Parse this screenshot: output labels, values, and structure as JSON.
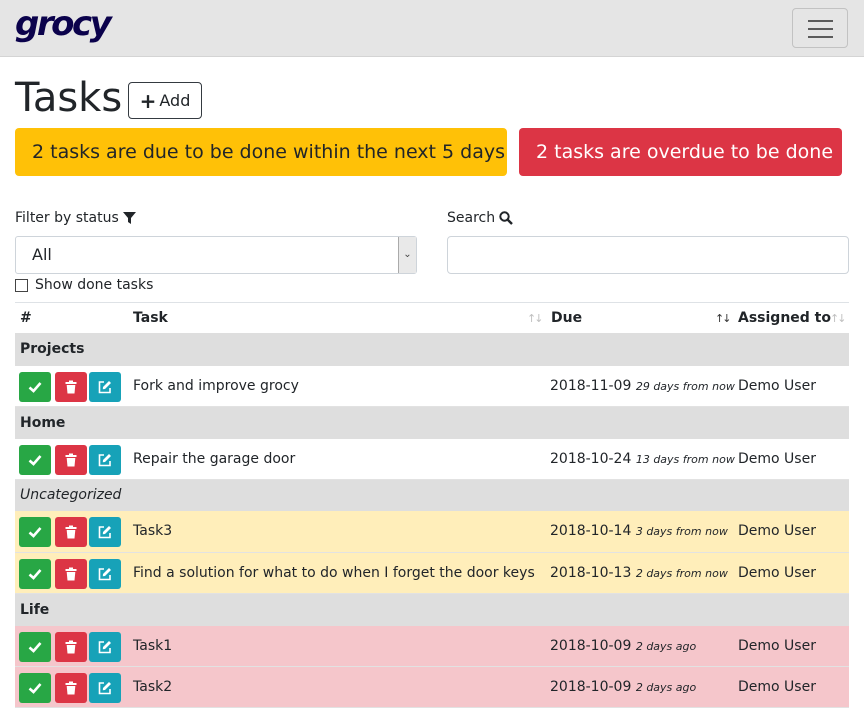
{
  "navbar": {
    "brand": "grocy"
  },
  "page": {
    "title": "Tasks",
    "add_label": "Add"
  },
  "alerts": {
    "due_soon": "2 tasks are due to be done within the next 5 days",
    "overdue": "2 tasks are overdue to be done"
  },
  "filter": {
    "label": "Filter by status",
    "selected": "All"
  },
  "search": {
    "label": "Search",
    "value": ""
  },
  "show_done": {
    "label": "Show done tasks",
    "checked": false
  },
  "table": {
    "columns": {
      "index": "#",
      "task": "Task",
      "due": "Due",
      "assigned": "Assigned to"
    },
    "groups": {
      "projects": "Projects",
      "home": "Home",
      "uncategorized": "Uncategorized",
      "life": "Life"
    },
    "rows": [
      {
        "name": "Fork and improve grocy",
        "due_date": "2018-11-09",
        "due_relative": "29 days from now",
        "assigned": "Demo User",
        "status": "normal"
      },
      {
        "name": "Repair the garage door",
        "due_date": "2018-10-24",
        "due_relative": "13 days from now",
        "assigned": "Demo User",
        "status": "normal"
      },
      {
        "name": "Task3",
        "due_date": "2018-10-14",
        "due_relative": "3 days from now",
        "assigned": "Demo User",
        "status": "warning"
      },
      {
        "name": "Find a solution for what to do when I forget the door keys",
        "due_date": "2018-10-13",
        "due_relative": "2 days from now",
        "assigned": "Demo User",
        "status": "warning"
      },
      {
        "name": "Task1",
        "due_date": "2018-10-09",
        "due_relative": "2 days ago",
        "assigned": "Demo User",
        "status": "danger"
      },
      {
        "name": "Task2",
        "due_date": "2018-10-09",
        "due_relative": "2 days ago",
        "assigned": "Demo User",
        "status": "danger"
      }
    ]
  },
  "colors": {
    "brand": "#0b024c",
    "success": "#28a745",
    "danger": "#dc3545",
    "info": "#17a2b8",
    "warning": "#ffc107",
    "row_warning": "#ffeeba",
    "row_danger": "#f5c6cb",
    "group_bg": "#dedede"
  },
  "icons": {
    "done": "check-icon",
    "delete": "trash-icon",
    "edit": "edit-icon",
    "filter": "filter-icon",
    "search": "search-icon",
    "menu": "hamburger-icon"
  }
}
